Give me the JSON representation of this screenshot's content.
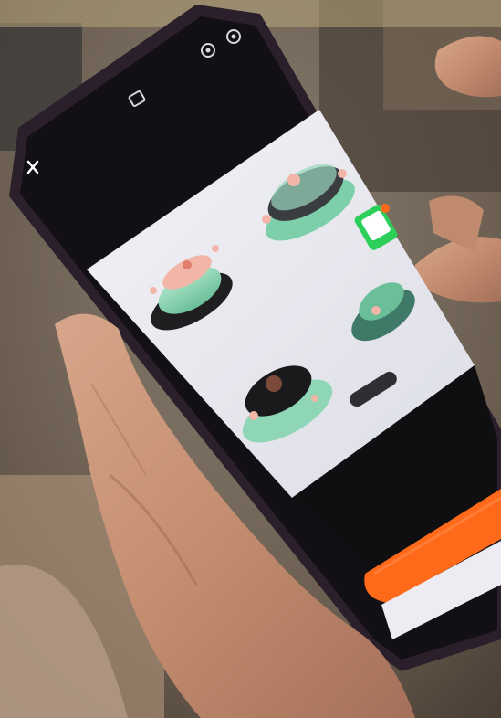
{
  "photo": {
    "subject": "hand-holding-phone",
    "screen_app": {
      "close_icon": "close-icon",
      "top_icons": [
        "camera-flip-icon",
        "settings-icon"
      ],
      "center_icon": "scan-icon",
      "badge_label": "",
      "primary_button_label": "",
      "product_items": [
        "hotpot-pink-lid",
        "hotpot-green-lid",
        "hotpot-dark-lid",
        "hotpot-green-small"
      ],
      "colors": {
        "accent_orange": "#ff6a1a",
        "screen_bg": "#e8e8ef",
        "pot_green": "#8fd6b6",
        "phone_frame": "#2a1f2a"
      }
    }
  }
}
